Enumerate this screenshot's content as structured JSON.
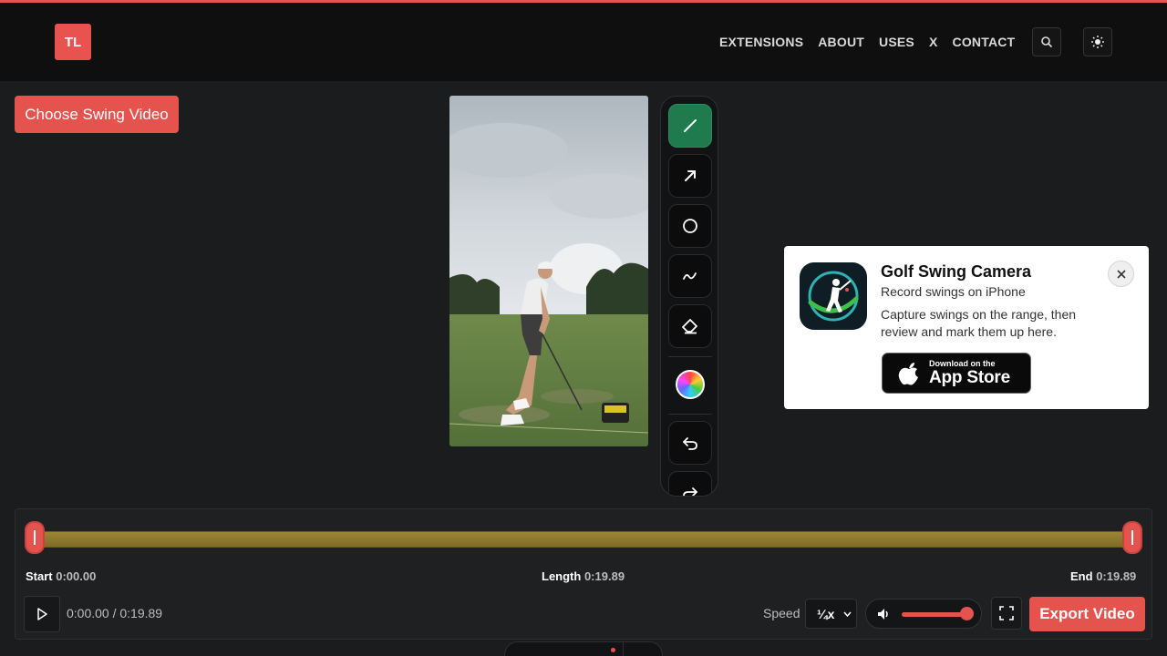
{
  "header": {
    "logo_text": "TL",
    "nav": [
      "EXTENSIONS",
      "ABOUT",
      "USES",
      "X",
      "CONTACT"
    ]
  },
  "actions": {
    "choose_label": "Choose Swing Video"
  },
  "toolbar": {
    "tools": [
      "line-tool",
      "arrow-tool",
      "circle-tool",
      "freehand-tool",
      "eraser-tool",
      "color-picker",
      "undo",
      "redo"
    ]
  },
  "promo": {
    "title": "Golf Swing Camera",
    "subtitle": "Record swings on iPhone",
    "description": "Capture swings on the range, then review and mark them up here.",
    "store_small": "Download on the",
    "store_big": "App Store"
  },
  "timeline": {
    "start_label": "Start",
    "start_value": "0:00.00",
    "length_label": "Length",
    "length_value": "0:19.89",
    "end_label": "End",
    "end_value": "0:19.89"
  },
  "controls": {
    "current_time": "0:00.00 / 0:19.89",
    "speed_label": "Speed",
    "speed_value": "¼x",
    "volume_level": 0.9,
    "export_label": "Export Video"
  },
  "colors": {
    "accent": "#e5534f",
    "active_tool": "#1f7a4e",
    "trim": "#9a8633"
  }
}
